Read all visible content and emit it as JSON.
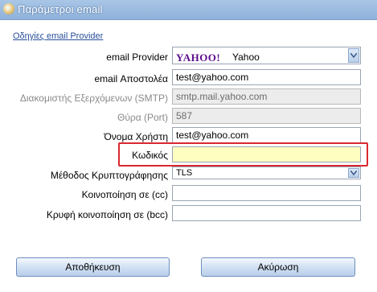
{
  "window": {
    "title": "Παράμετροι email"
  },
  "help_link": "Οδηγίες email Provider",
  "form": {
    "provider": {
      "label": "email Provider",
      "logo_text": "YAHOO!",
      "value": "Yahoo"
    },
    "sender": {
      "label": "email Αποστολέα",
      "value": "test@yahoo.com"
    },
    "smtp": {
      "label": "Διακομιστής Εξερχόμενων (SMTP)",
      "value": "smtp.mail.yahoo.com"
    },
    "port": {
      "label": "Θύρα (Port)",
      "value": "587"
    },
    "username": {
      "label": "Όνομα Χρήστη",
      "value": "test@yahoo.com"
    },
    "password": {
      "label": "Κωδικός",
      "value": ""
    },
    "encryption": {
      "label": "Μέθοδος Κρυπτογράφησης",
      "value": "TLS"
    },
    "cc": {
      "label": "Κοινοποίηση σε (cc)",
      "value": ""
    },
    "bcc": {
      "label": "Κρυφή κοινοποίηση σε (bcc)",
      "value": ""
    }
  },
  "buttons": {
    "save": "Αποθήκευση",
    "cancel": "Ακύρωση"
  },
  "colors": {
    "highlight_border": "#d9282e",
    "password_bg": "#fefec0",
    "link": "#2a4f9a"
  }
}
